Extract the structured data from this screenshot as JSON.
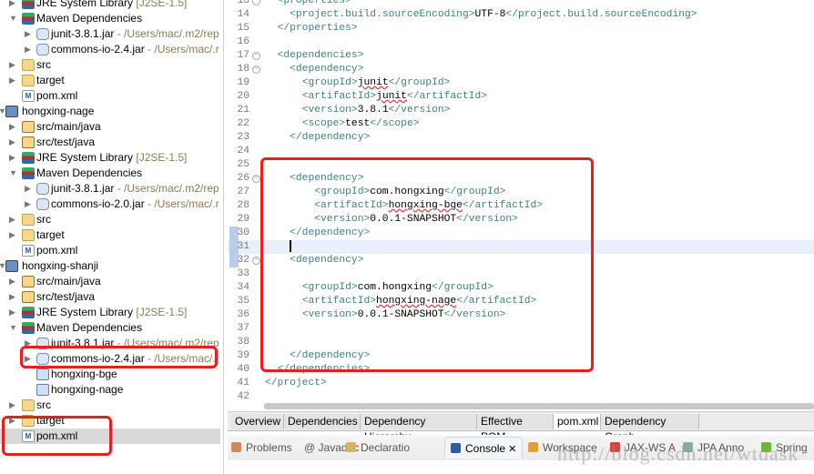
{
  "project_explorer": {
    "items": [
      {
        "depth": 1,
        "arrow": "collapsed",
        "icon": "library",
        "label": "JRE System Library",
        "suffix": " [J2SE-1.5]"
      },
      {
        "depth": 1,
        "arrow": "expanded",
        "icon": "library",
        "label": "Maven Dependencies",
        "suffix": ""
      },
      {
        "depth": 2,
        "arrow": "collapsed",
        "icon": "jar",
        "label": "junit-3.8.1.jar",
        "suffix": " - /Users/mac/.m2/rep"
      },
      {
        "depth": 2,
        "arrow": "collapsed",
        "icon": "jar",
        "label": "commons-io-2.4.jar",
        "suffix": " - /Users/mac/.r"
      },
      {
        "depth": 1,
        "arrow": "collapsed",
        "icon": "folder",
        "label": "src",
        "suffix": ""
      },
      {
        "depth": 1,
        "arrow": "collapsed",
        "icon": "folder",
        "label": "target",
        "suffix": ""
      },
      {
        "depth": 1,
        "arrow": "none",
        "icon": "pom",
        "label": "pom.xml",
        "suffix": ""
      },
      {
        "depth": 0,
        "arrow": "expanded",
        "icon": "project",
        "label": "hongxing-nage",
        "suffix": ""
      },
      {
        "depth": 1,
        "arrow": "collapsed",
        "icon": "package",
        "label": "src/main/java",
        "suffix": ""
      },
      {
        "depth": 1,
        "arrow": "collapsed",
        "icon": "package",
        "label": "src/test/java",
        "suffix": ""
      },
      {
        "depth": 1,
        "arrow": "collapsed",
        "icon": "library",
        "label": "JRE System Library",
        "suffix": " [J2SE-1.5]"
      },
      {
        "depth": 1,
        "arrow": "expanded",
        "icon": "library",
        "label": "Maven Dependencies",
        "suffix": ""
      },
      {
        "depth": 2,
        "arrow": "collapsed",
        "icon": "jar",
        "label": "junit-3.8.1.jar",
        "suffix": " - /Users/mac/.m2/rep"
      },
      {
        "depth": 2,
        "arrow": "collapsed",
        "icon": "jar",
        "label": "commons-io-2.0.jar",
        "suffix": " - /Users/mac/.r"
      },
      {
        "depth": 1,
        "arrow": "collapsed",
        "icon": "folder",
        "label": "src",
        "suffix": ""
      },
      {
        "depth": 1,
        "arrow": "collapsed",
        "icon": "folder",
        "label": "target",
        "suffix": ""
      },
      {
        "depth": 1,
        "arrow": "none",
        "icon": "pom",
        "label": "pom.xml",
        "suffix": ""
      },
      {
        "depth": 0,
        "arrow": "expanded",
        "icon": "project",
        "label": "hongxing-shanji",
        "suffix": ""
      },
      {
        "depth": 1,
        "arrow": "collapsed",
        "icon": "package",
        "label": "src/main/java",
        "suffix": ""
      },
      {
        "depth": 1,
        "arrow": "collapsed",
        "icon": "package",
        "label": "src/test/java",
        "suffix": ""
      },
      {
        "depth": 1,
        "arrow": "collapsed",
        "icon": "library",
        "label": "JRE System Library",
        "suffix": " [J2SE-1.5]"
      },
      {
        "depth": 1,
        "arrow": "expanded",
        "icon": "library",
        "label": "Maven Dependencies",
        "suffix": ""
      },
      {
        "depth": 2,
        "arrow": "collapsed",
        "icon": "jar",
        "label": "junit-3.8.1.jar",
        "suffix": " - /Users/mac/.m2/rep"
      },
      {
        "depth": 2,
        "arrow": "collapsed",
        "icon": "jar",
        "label": "commons-io-2.4.jar",
        "suffix": " - /Users/mac/.r"
      },
      {
        "depth": 2,
        "arrow": "none",
        "icon": "project-folder",
        "label": "hongxing-bge",
        "suffix": ""
      },
      {
        "depth": 2,
        "arrow": "none",
        "icon": "project-folder",
        "label": "hongxing-nage",
        "suffix": ""
      },
      {
        "depth": 1,
        "arrow": "collapsed",
        "icon": "folder",
        "label": "src",
        "suffix": ""
      },
      {
        "depth": 1,
        "arrow": "collapsed",
        "icon": "folder",
        "label": "target",
        "suffix": ""
      },
      {
        "depth": 1,
        "arrow": "none",
        "icon": "pom",
        "label": "pom.xml",
        "suffix": "",
        "selected": true
      }
    ]
  },
  "editor": {
    "lines": [
      {
        "n": "13",
        "fold": true,
        "indent": 1,
        "parts": [
          [
            "tag",
            "<properties>"
          ]
        ]
      },
      {
        "n": "14",
        "indent": 2,
        "parts": [
          [
            "tag",
            "<project.build.sourceEncoding>"
          ],
          [
            "txt",
            "UTF-8"
          ],
          [
            "tag",
            "</project.build.sourceEncoding>"
          ]
        ]
      },
      {
        "n": "15",
        "indent": 1,
        "parts": [
          [
            "tag",
            "</properties>"
          ]
        ]
      },
      {
        "n": "16",
        "indent": 0,
        "parts": []
      },
      {
        "n": "17",
        "fold": true,
        "indent": 1,
        "parts": [
          [
            "tag",
            "<dependencies>"
          ]
        ]
      },
      {
        "n": "18",
        "fold": true,
        "indent": 2,
        "parts": [
          [
            "tag",
            "<dependency>"
          ]
        ]
      },
      {
        "n": "19",
        "indent": 3,
        "parts": [
          [
            "tag",
            "<groupId>"
          ],
          [
            "sq",
            "junit"
          ],
          [
            "tag",
            "</groupId>"
          ]
        ]
      },
      {
        "n": "20",
        "indent": 3,
        "parts": [
          [
            "tag",
            "<artifactId>"
          ],
          [
            "sq",
            "junit"
          ],
          [
            "tag",
            "</artifactId>"
          ]
        ]
      },
      {
        "n": "21",
        "indent": 3,
        "parts": [
          [
            "tag",
            "<version>"
          ],
          [
            "txt",
            "3.8.1"
          ],
          [
            "tag",
            "</version>"
          ]
        ]
      },
      {
        "n": "22",
        "indent": 3,
        "parts": [
          [
            "tag",
            "<scope>"
          ],
          [
            "txt",
            "test"
          ],
          [
            "tag",
            "</scope>"
          ]
        ]
      },
      {
        "n": "23",
        "indent": 2,
        "parts": [
          [
            "tag",
            "</dependency>"
          ]
        ]
      },
      {
        "n": "24",
        "indent": 0,
        "parts": []
      },
      {
        "n": "25",
        "indent": 0,
        "parts": []
      },
      {
        "n": "26",
        "fold": true,
        "indent": 2,
        "parts": [
          [
            "tag",
            "<dependency>"
          ]
        ]
      },
      {
        "n": "27",
        "indent": 4,
        "parts": [
          [
            "tag",
            "<groupId>"
          ],
          [
            "txt",
            "com.hongxing"
          ],
          [
            "tag",
            "</groupId>"
          ]
        ]
      },
      {
        "n": "28",
        "indent": 4,
        "parts": [
          [
            "tag",
            "<artifactId>"
          ],
          [
            "sq",
            "hongxing-bge"
          ],
          [
            "tag",
            "</artifactId>"
          ]
        ]
      },
      {
        "n": "29",
        "indent": 4,
        "parts": [
          [
            "tag",
            "<version>"
          ],
          [
            "txt",
            "0.0.1-SNAPSHOT"
          ],
          [
            "tag",
            "</version>"
          ]
        ]
      },
      {
        "n": "30",
        "changed": true,
        "indent": 2,
        "parts": [
          [
            "tag",
            "</dependency>"
          ]
        ]
      },
      {
        "n": "31",
        "changed": true,
        "current": true,
        "indent": 2,
        "parts": []
      },
      {
        "n": "32",
        "changed": true,
        "fold": true,
        "indent": 2,
        "parts": [
          [
            "tag",
            "<dependency>"
          ]
        ]
      },
      {
        "n": "33",
        "indent": 0,
        "parts": []
      },
      {
        "n": "34",
        "indent": 3,
        "parts": [
          [
            "tag",
            "<groupId>"
          ],
          [
            "txt",
            "com.hongxing"
          ],
          [
            "tag",
            "</groupId>"
          ]
        ]
      },
      {
        "n": "35",
        "indent": 3,
        "parts": [
          [
            "tag",
            "<artifactId>"
          ],
          [
            "sq",
            "hongxing-nage"
          ],
          [
            "tag",
            "</artifactId>"
          ]
        ]
      },
      {
        "n": "36",
        "indent": 3,
        "parts": [
          [
            "tag",
            "<version>"
          ],
          [
            "txt",
            "0.0.1-SNAPSHOT"
          ],
          [
            "tag",
            "</version>"
          ]
        ]
      },
      {
        "n": "37",
        "indent": 0,
        "parts": []
      },
      {
        "n": "38",
        "indent": 0,
        "parts": []
      },
      {
        "n": "39",
        "indent": 2,
        "parts": [
          [
            "tag",
            "</dependency>"
          ]
        ]
      },
      {
        "n": "40",
        "indent": 1,
        "parts": [
          [
            "tag",
            "</dependencies>"
          ]
        ]
      },
      {
        "n": "41",
        "indent": 0,
        "parts": [
          [
            "tag",
            "</project>"
          ]
        ]
      },
      {
        "n": "42",
        "indent": 0,
        "parts": []
      }
    ]
  },
  "pom_tabs": [
    "Overview",
    "Dependencies",
    "Dependency Hierarchy",
    "Effective POM",
    "pom.xml",
    "Dependency Graph"
  ],
  "pom_active_tab": "pom.xml",
  "view_tabs": [
    {
      "label": "Problems",
      "icon": "problems-icon",
      "color": "#c86"
    },
    {
      "label": "@ Javadoc",
      "icon": "",
      "color": ""
    },
    {
      "label": "Declaratio",
      "icon": "declaration-icon",
      "color": "#d9b26a"
    },
    {
      "label": "Console",
      "icon": "console-icon",
      "color": "#2a5aa8",
      "active": true
    },
    {
      "label": "Workspace",
      "icon": "workspace-icon",
      "color": "#e0a040"
    },
    {
      "label": "JAX-WS A",
      "icon": "jaxws-icon",
      "color": "#c44"
    },
    {
      "label": "JPA Anno",
      "icon": "jpa-icon",
      "color": "#8aa"
    },
    {
      "label": "Spring",
      "icon": "spring-icon",
      "color": "#6b3"
    }
  ],
  "watermark": "http://blog.csdn.net/wtdask",
  "colors": {
    "annotation": "#ee1c1c",
    "xml_tag": "#3f7f7f",
    "current_line": "#e8f0fb"
  }
}
